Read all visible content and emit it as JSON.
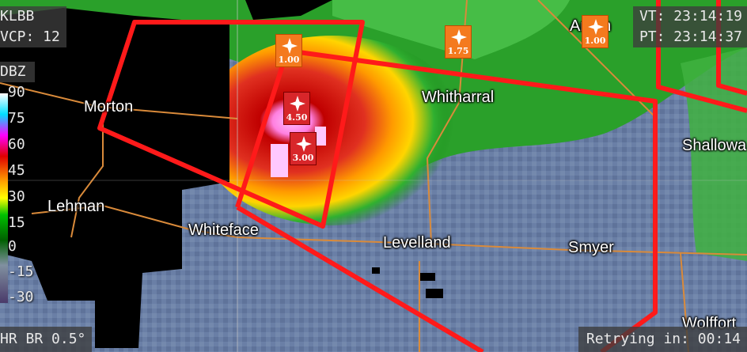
{
  "header": {
    "station_label": "KLBB",
    "vcp_label": "VCP: 12"
  },
  "times": {
    "vt": "VT: 23:14:19",
    "pt": "PT: 23:14:37"
  },
  "product": {
    "label": "HR BR 0.5°"
  },
  "status": {
    "retry": "Retrying in: 00:14"
  },
  "legend": {
    "title": "DBZ",
    "ticks": [
      "90",
      "75",
      "60",
      "45",
      "30",
      "15",
      "0",
      "-15",
      "-30"
    ]
  },
  "cities": [
    {
      "id": "morton",
      "name": "Morton"
    },
    {
      "id": "lehman",
      "name": "Lehman"
    },
    {
      "id": "whiteface",
      "name": "Whiteface"
    },
    {
      "id": "whitharral",
      "name": "Whitharral"
    },
    {
      "id": "levelland",
      "name": "Levelland"
    },
    {
      "id": "smyer",
      "name": "Smyer"
    },
    {
      "id": "shallowater",
      "name": "Shallowa"
    },
    {
      "id": "wolfforth",
      "name": "Wolffort"
    },
    {
      "id": "anton",
      "name": "Anton"
    }
  ],
  "hail_markers": [
    {
      "id": "m1",
      "value": "1.00",
      "style": "orange"
    },
    {
      "id": "m2",
      "value": "1.75",
      "style": "orange"
    },
    {
      "id": "m3",
      "value": "1.00",
      "style": "orange"
    },
    {
      "id": "m4",
      "value": "4.50",
      "style": "red"
    },
    {
      "id": "m5",
      "value": "3.00",
      "style": "red"
    }
  ],
  "colors": {
    "warning_polygon": "#ff1a1a",
    "county_roads": "#d98a3a",
    "hail_orange": "#f47a1e",
    "hail_red": "#d8262a"
  }
}
